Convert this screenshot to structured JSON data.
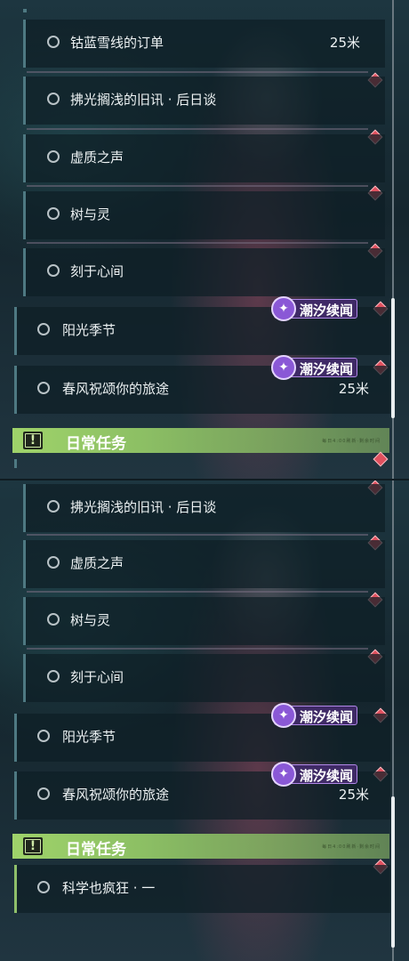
{
  "badge_label": "潮汐续闻",
  "daily_header": {
    "title": "日常任务",
    "icon": "alert-icon",
    "icon_glyph": "!",
    "fine_text": "每日4:00刷新·剩余时间"
  },
  "panel_top": {
    "rows": [
      {
        "label": "钴蓝雪线的订单",
        "distance": "25米"
      },
      {
        "label": "拂光搁浅的旧讯 · 后日谈"
      },
      {
        "label": "虚质之声"
      },
      {
        "label": "树与灵"
      },
      {
        "label": "刻于心间"
      },
      {
        "label": "阳光季节",
        "badge": "潮汐续闻"
      },
      {
        "label": "春风祝颂你的旅途",
        "badge": "潮汐续闻",
        "distance": "25米"
      }
    ]
  },
  "panel_bottom": {
    "rows": [
      {
        "label": "拂光搁浅的旧讯 · 后日谈"
      },
      {
        "label": "虚质之声"
      },
      {
        "label": "树与灵"
      },
      {
        "label": "刻于心间"
      },
      {
        "label": "阳光季节",
        "badge": "潮汐续闻"
      },
      {
        "label": "春风祝颂你的旅途",
        "badge": "潮汐续闻",
        "distance": "25米"
      },
      {
        "label": "科学也疯狂 · 一"
      }
    ]
  },
  "colors": {
    "track_marker": "#e0505e",
    "badge_purple": "#8a58d6",
    "daily_green": "#9fd36a"
  }
}
